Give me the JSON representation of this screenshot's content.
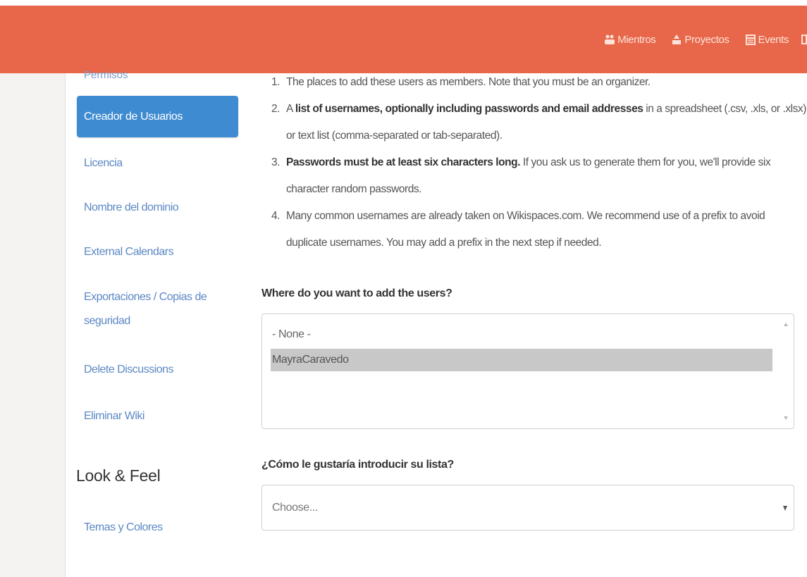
{
  "header": {
    "nav": [
      {
        "label": "Mientros",
        "icon": "members-icon"
      },
      {
        "label": "Proyectos",
        "icon": "projects-icon"
      },
      {
        "label": "Events",
        "icon": "events-icon"
      }
    ],
    "accent_color": "#e8674a"
  },
  "sidebar": {
    "cut_item": "Permisos",
    "active_item": "Creador de Usuarios",
    "items": [
      "Licencia",
      "Nombre del dominio",
      "External Calendars",
      "Exportaciones / Copias de seguridad",
      "Delete Discussions",
      "Eliminar Wiki"
    ],
    "section_heading": "Look & Feel",
    "section_items": [
      "Temas y Colores"
    ],
    "active_color": "#3f8bd1"
  },
  "instructions": [
    {
      "num": "1.",
      "before": "The places to add these users as members. Note that you must be an organizer.",
      "bold": "",
      "after": ""
    },
    {
      "num": "2.",
      "before": "A ",
      "bold": "list of usernames, optionally including passwords and email addresses",
      "after": " in a spreadsheet (.csv, .xls, or .xlsx) or text list (comma-separated or tab-separated)."
    },
    {
      "num": "3.",
      "before": "",
      "bold": "Passwords must be at least six characters long.",
      "after": " If you ask us to generate them for you, we'll provide six character random passwords."
    },
    {
      "num": "4.",
      "before": "Many common usernames are already taken on Wikispaces.com. We recommend use of a prefix to avoid duplicate usernames. You may add a prefix in the next step if needed.",
      "bold": "",
      "after": ""
    }
  ],
  "where": {
    "label": "Where do you want to add the users?",
    "options": [
      "- None -",
      "MayraCaravedo"
    ],
    "selected": "MayraCaravedo"
  },
  "how": {
    "label": "¿Cómo le gustaría introducir su lista?",
    "placeholder": "Choose..."
  }
}
